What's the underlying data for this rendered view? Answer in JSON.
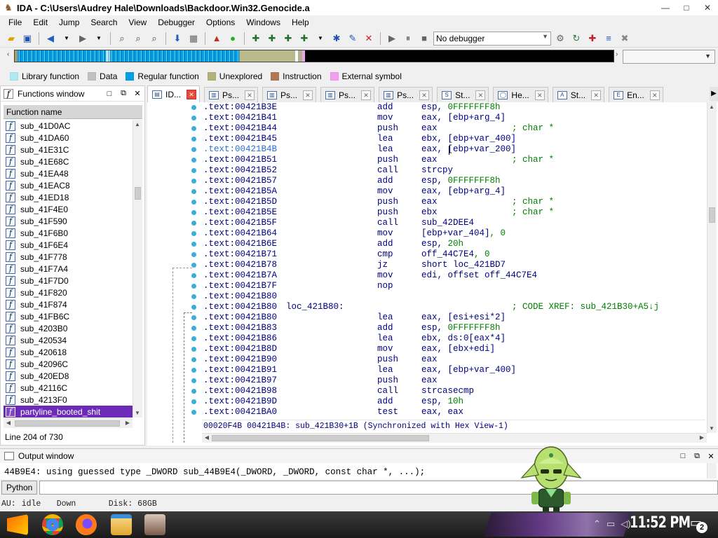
{
  "window": {
    "title": "IDA - C:\\Users\\Audrey Hale\\Downloads\\Backdoor.Win32.Genocide.a",
    "minimize": "—",
    "maximize": "□",
    "close": "✕"
  },
  "menu": [
    "File",
    "Edit",
    "Jump",
    "Search",
    "View",
    "Debugger",
    "Options",
    "Windows",
    "Help"
  ],
  "toolbar": {
    "debugger_select": "No debugger"
  },
  "legend": [
    {
      "label": "Library function",
      "color": "#aee8f5"
    },
    {
      "label": "Data",
      "color": "#c0c0c0"
    },
    {
      "label": "Regular function",
      "color": "#00a0e8"
    },
    {
      "label": "Unexplored",
      "color": "#b3b27a"
    },
    {
      "label": "Instruction",
      "color": "#b07850"
    },
    {
      "label": "External symbol",
      "color": "#f29ef2"
    }
  ],
  "functions_window": {
    "title": "Functions window",
    "column": "Function name",
    "items": [
      "sub_41D0AC",
      "sub_41DA60",
      "sub_41E31C",
      "sub_41E68C",
      "sub_41EA48",
      "sub_41EAC8",
      "sub_41ED18",
      "sub_41F4E0",
      "sub_41F590",
      "sub_41F6B0",
      "sub_41F6E4",
      "sub_41F778",
      "sub_41F7A4",
      "sub_41F7D0",
      "sub_41F820",
      "sub_41F874",
      "sub_41FB6C",
      "sub_4203B0",
      "sub_420534",
      "sub_420618",
      "sub_42096C",
      "sub_420ED8",
      "sub_42116C",
      "sub_4213F0",
      "partyline_booted_shit"
    ],
    "selected_index": 24,
    "line_info": "Line 204 of 730"
  },
  "tabs": [
    {
      "label": "ID...",
      "active": true
    },
    {
      "label": "Ps...",
      "active": false
    },
    {
      "label": "Ps...",
      "active": false
    },
    {
      "label": "Ps...",
      "active": false
    },
    {
      "label": "Ps...",
      "active": false
    },
    {
      "label": "St...",
      "active": false
    },
    {
      "label": "He...",
      "active": false
    },
    {
      "label": "St...",
      "active": false
    },
    {
      "label": "En...",
      "active": false
    }
  ],
  "disassembly": [
    {
      "addr": ".text:00421B3E",
      "mn": "add",
      "op": "esp, 0FFFFFFF8h"
    },
    {
      "addr": ".text:00421B41",
      "mn": "mov",
      "op": "eax, [ebp+arg_4]"
    },
    {
      "addr": ".text:00421B44",
      "mn": "push",
      "op": "eax",
      "cm": "; char *"
    },
    {
      "addr": ".text:00421B45",
      "mn": "lea",
      "op": "ebx, [ebp+var_400]"
    },
    {
      "addr": ".text:00421B4B",
      "mn": "lea",
      "op": "eax, [ebp+var_200]",
      "hl": true
    },
    {
      "addr": ".text:00421B51",
      "mn": "push",
      "op": "eax",
      "cm": "; char *"
    },
    {
      "addr": ".text:00421B52",
      "mn": "call",
      "op": "strcpy"
    },
    {
      "addr": ".text:00421B57",
      "mn": "add",
      "op": "esp, 0FFFFFFF8h"
    },
    {
      "addr": ".text:00421B5A",
      "mn": "mov",
      "op": "eax, [ebp+arg_4]"
    },
    {
      "addr": ".text:00421B5D",
      "mn": "push",
      "op": "eax",
      "cm": "; char *"
    },
    {
      "addr": ".text:00421B5E",
      "mn": "push",
      "op": "ebx",
      "cm": "; char *"
    },
    {
      "addr": ".text:00421B5F",
      "mn": "call",
      "op": "sub_42DEE4"
    },
    {
      "addr": ".text:00421B64",
      "mn": "mov",
      "op": "[ebp+var_404], 0"
    },
    {
      "addr": ".text:00421B6E",
      "mn": "add",
      "op": "esp, 20h"
    },
    {
      "addr": ".text:00421B71",
      "mn": "cmp",
      "op": "off_44C7E4, 0"
    },
    {
      "addr": ".text:00421B78",
      "mn": "jz",
      "op": "short loc_421BD7"
    },
    {
      "addr": ".text:00421B7A",
      "mn": "mov",
      "op": "edi, offset off_44C7E4"
    },
    {
      "addr": ".text:00421B7F",
      "mn": "nop",
      "op": ""
    },
    {
      "addr": ".text:00421B80",
      "mn": "",
      "op": ""
    },
    {
      "addr": ".text:00421B80",
      "label": "loc_421B80:",
      "mn": "",
      "op": "",
      "cm": "; CODE XREF: sub_421B30+A5↓j"
    },
    {
      "addr": ".text:00421B80",
      "mn": "lea",
      "op": "eax, [esi+esi*2]"
    },
    {
      "addr": ".text:00421B83",
      "mn": "add",
      "op": "esp, 0FFFFFFF8h"
    },
    {
      "addr": ".text:00421B86",
      "mn": "lea",
      "op": "ebx, ds:0[eax*4]"
    },
    {
      "addr": ".text:00421B8D",
      "mn": "mov",
      "op": "eax, [ebx+edi]"
    },
    {
      "addr": ".text:00421B90",
      "mn": "push",
      "op": "eax"
    },
    {
      "addr": ".text:00421B91",
      "mn": "lea",
      "op": "eax, [ebp+var_400]"
    },
    {
      "addr": ".text:00421B97",
      "mn": "push",
      "op": "eax"
    },
    {
      "addr": ".text:00421B98",
      "mn": "call",
      "op": "strcasecmp"
    },
    {
      "addr": ".text:00421B9D",
      "mn": "add",
      "op": "esp, 10h"
    },
    {
      "addr": ".text:00421BA0",
      "mn": "test",
      "op": "eax, eax"
    }
  ],
  "disasm_status": "00020F4B 00421B4B: sub_421B30+1B (Synchronized with Hex View-1)",
  "output": {
    "title": "Output window",
    "text": "44B9E4: using guessed type _DWORD sub_44B9E4(_DWORD, _DWORD, const char *, ...);",
    "python_button": "Python"
  },
  "status": {
    "au": "AU:",
    "au_state": "idle",
    "direction": "Down",
    "disk": "Disk: 68GB"
  },
  "taskbar": {
    "clock": "11:52 PM",
    "notifications": "2"
  }
}
